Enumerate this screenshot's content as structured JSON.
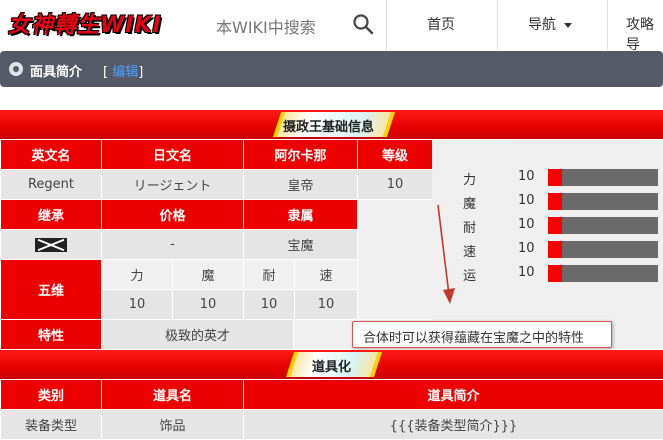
{
  "header": {
    "logo_text": "女神轉生WIKI",
    "search_placeholder": "本WIKI中搜索",
    "nav": [
      "首页",
      "导航",
      "攻略导"
    ]
  },
  "section": {
    "title": "面具简介",
    "edit_open": "[",
    "edit_label": "编辑",
    "edit_close": "]"
  },
  "banner1": "摄政王基础信息",
  "banner2": "道具化",
  "info": {
    "headers_row1": [
      "英文名",
      "日文名",
      "阿尔卡那",
      "等级"
    ],
    "values_row1": [
      "Regent",
      "リージェント",
      "皇帝",
      "10"
    ],
    "headers_row2": [
      "继承",
      "价格",
      "隶属"
    ],
    "values_row2": [
      "",
      "-",
      "宝魔"
    ],
    "stats_label": "五维",
    "stat_names": [
      "力",
      "魔",
      "耐",
      "速",
      "运"
    ],
    "stat_values": [
      "10",
      "10",
      "10",
      "10",
      "10"
    ],
    "trait_label": "特性",
    "trait_value": "极致的英才"
  },
  "stats_panel": [
    {
      "label": "力",
      "value": "10",
      "fill": 0.13
    },
    {
      "label": "魔",
      "value": "10",
      "fill": 0.13
    },
    {
      "label": "耐",
      "value": "10",
      "fill": 0.13
    },
    {
      "label": "速",
      "value": "10",
      "fill": 0.13
    },
    {
      "label": "运",
      "value": "10",
      "fill": 0.13
    }
  ],
  "tooltip": "合体时可以获得蕴藏在宝魔之中的特性",
  "item": {
    "headers": [
      "类别",
      "道具名",
      "道具简介"
    ],
    "values": [
      "装备类型",
      "饰品",
      "{{{装备类型简介}}}"
    ]
  },
  "colors": {
    "accent": "#ee0000",
    "section_bar": "#565a66",
    "bar_track": "#6a6a6a"
  }
}
